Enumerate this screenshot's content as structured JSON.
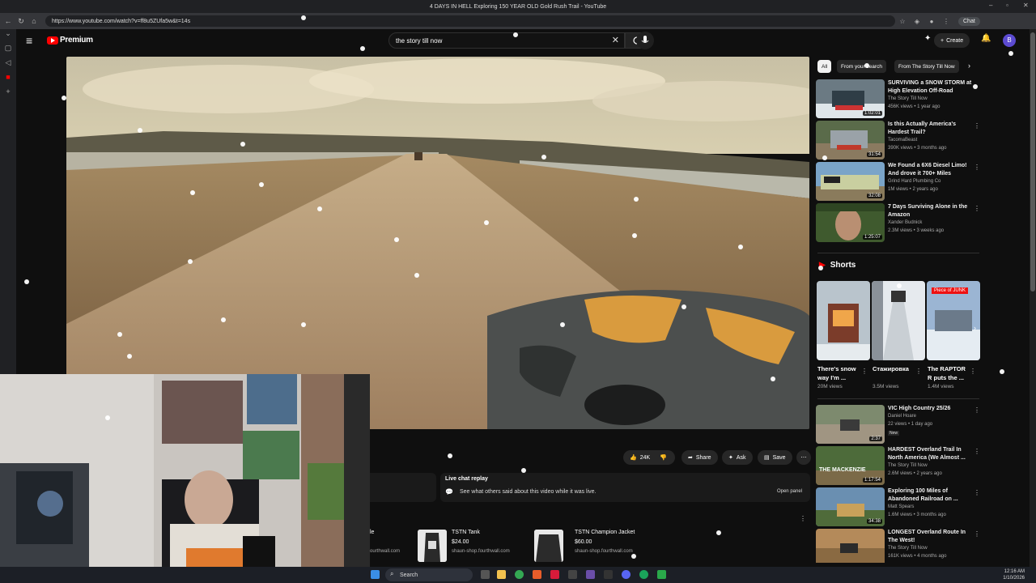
{
  "window": {
    "title": "4 DAYS IN HELL Exploring 150 YEAR OLD Gold Rush Trail - YouTube"
  },
  "browser": {
    "url": "https://www.youtube.com/watch?v=ff8u5ZUfa5w&t=14s",
    "chat_label": "Chat"
  },
  "header": {
    "logo_text": "Premium",
    "search_value": "the story till now",
    "create_label": "Create",
    "avatar_letter": "B"
  },
  "actions": {
    "likes": "24K",
    "share": "Share",
    "ask": "Ask",
    "save": "Save"
  },
  "live_chat": {
    "title": "Live chat replay",
    "description": "See what others said about this video while it was live.",
    "button": "Open panel"
  },
  "merch": [
    {
      "name": "TSTN Tank",
      "price": "$24.00",
      "store": "shaun-shop.fourthwall.com"
    },
    {
      "name": "TSTN Champion Jacket",
      "price": "$60.00",
      "store": "shaun-shop.fourthwall.com"
    }
  ],
  "merch_partial": {
    "name_tail": "le",
    "store_tail": "ourthwall.com"
  },
  "chips": [
    "All",
    "From your search",
    "From The Story Till Now"
  ],
  "recommendations_top": [
    {
      "title": "SURVIVING a SNOW STORM at High Elevation Off-Road",
      "channel": "The Story Till Now",
      "meta": "456K views • 1 year ago",
      "duration": "1:02:01"
    },
    {
      "title": "Is this Actually America's Hardest Trail?",
      "channel": "TacomaBeast",
      "meta": "390K views • 3 months ago",
      "duration": "31:54"
    },
    {
      "title": "We Found a 6X6 Diesel Limo! And drove it 700+ Miles",
      "channel": "Grind Hard Plumbing Co",
      "meta": "1M views • 2 years ago",
      "duration": "32:08"
    },
    {
      "title": "7 Days Surviving Alone in the Amazon",
      "channel": "Xander Budnick",
      "meta": "2.3M views • 3 weeks ago",
      "duration": "1:25:07"
    }
  ],
  "shorts": {
    "heading": "Shorts",
    "items": [
      {
        "title": "There's snow way I'm ...",
        "views": "20M views"
      },
      {
        "title": "Стажировка",
        "views": "3.5M views"
      },
      {
        "title": "The RAPTOR R puts the ...",
        "views": "1.4M views",
        "overlay": "Piece of JUNK"
      }
    ]
  },
  "recommendations_bottom": [
    {
      "title": "VIC High Country 25/26",
      "channel": "Daniel Hoare",
      "meta": "22 views • 1 day ago",
      "duration": "2:37",
      "badge": "New"
    },
    {
      "title": "HARDEST Overland Trail In North America (We Almost ...",
      "channel": "The Story Till Now",
      "meta": "2.6M views • 2 years ago",
      "duration": "1:17:54",
      "overlay": "THE MACKENZIE"
    },
    {
      "title": "Exploring 100 Miles of Abandoned Railroad on ...",
      "channel": "Matt Spears",
      "meta": "1.6M views • 3 months ago",
      "duration": "34:38"
    },
    {
      "title": "LONGEST Overland Route In The West!",
      "channel": "The Story Till Now",
      "meta": "161K views • 4 months ago",
      "duration": ""
    }
  ],
  "taskbar": {
    "search_label": "Search",
    "time": "12:16 AM",
    "date": "1/10/2026"
  },
  "colors": {
    "brand": "#ff0000",
    "background": "#0f0f0f",
    "surface": "#272727"
  }
}
